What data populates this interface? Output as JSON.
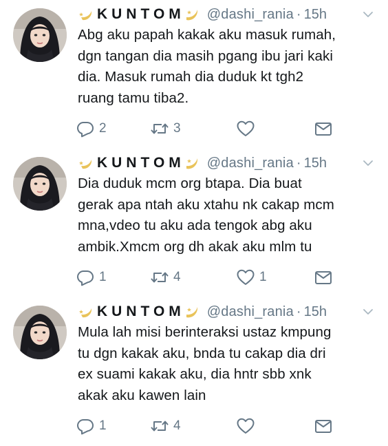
{
  "tweets": [
    {
      "name": "KUNTOM",
      "handle": "@dashi_rania",
      "dot": "·",
      "time": "15h",
      "text": "Abg aku papah kakak aku masuk rumah,\ndgn tangan dia masih pgang ibu jari kaki\ndia. Masuk rumah dia duduk kt tgh2\nruang tamu tiba2.",
      "replies": "2",
      "retweets": "3",
      "likes": ""
    },
    {
      "name": "KUNTOM",
      "handle": "@dashi_rania",
      "dot": "·",
      "time": "15h",
      "text": "Dia duduk mcm org btapa. Dia buat\ngerak apa ntah aku xtahu nk cakap mcm\nmna,vdeo tu aku ada tengok abg aku\nambik.Xmcm org dh akak aku mlm tu",
      "replies": "1",
      "retweets": "4",
      "likes": "1"
    },
    {
      "name": "KUNTOM",
      "handle": "@dashi_rania",
      "dot": "·",
      "time": "15h",
      "text": "Mula lah misi berinteraksi ustaz kmpung\ntu dgn kakak aku, bnda tu cakap dia dri\nex suami kakak aku, dia hntr sbb xnk\nakak aku kawen lain",
      "replies": "1",
      "retweets": "4",
      "likes": ""
    }
  ],
  "icons": {
    "reply": "reply-icon",
    "retweet": "retweet-icon",
    "like": "heart-icon",
    "message": "envelope-icon",
    "more": "chevron-down-icon",
    "name_decor": "crescent-moon-star-icon"
  },
  "colors": {
    "text": "#14171a",
    "secondary": "#657786",
    "moon": "#e9c35a"
  }
}
